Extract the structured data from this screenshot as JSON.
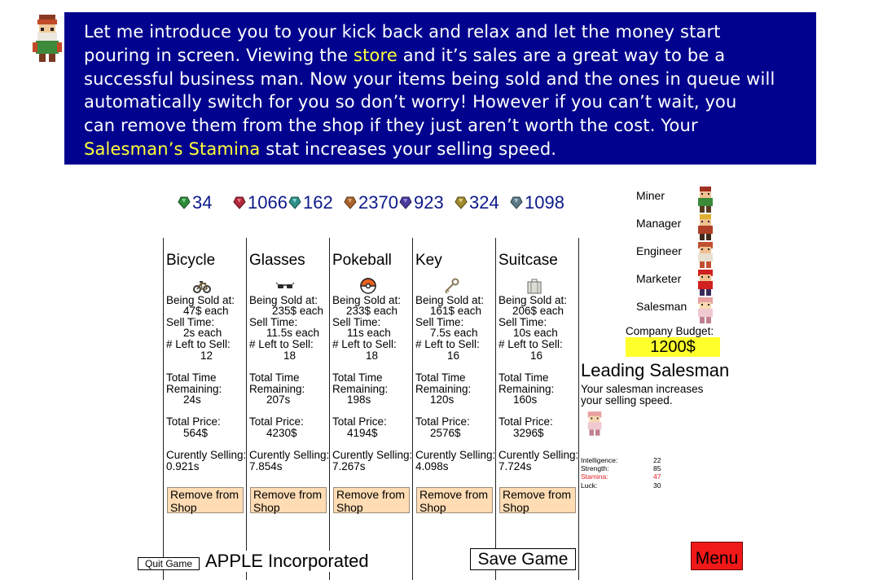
{
  "dialog": {
    "line1": "Let me introduce you to your kick back and relax and let the money start",
    "line2_pre": "pouring in screen. Viewing the ",
    "line2_hl": "store",
    "line2_post": " and it’s sales are a great way to be a",
    "line3": "successful business man. Now your items being sold and the ones in queue will",
    "line4": "automatically switch for you so don’t worry! However if you can’t wait, you",
    "line5": "can remove them from the shop if they just aren’t worth the cost. Your",
    "line6_hl": "Salesman’s Stamina",
    "line6_post": " stat increases your selling speed.",
    "highlight_color": "#ffff3a",
    "background_color": "#01038e"
  },
  "resources": [
    {
      "icon": "green-gem-icon",
      "color": "#2e8b3a",
      "value": "34"
    },
    {
      "icon": "red-gem-icon",
      "color": "#b0283a",
      "value": "1066"
    },
    {
      "icon": "teal-gem-icon",
      "color": "#2f8f88",
      "value": "162"
    },
    {
      "icon": "bronze-gem-icon",
      "color": "#a9642e",
      "value": "2370"
    },
    {
      "icon": "purple-gem-icon",
      "color": "#4a3c9a",
      "value": "923"
    },
    {
      "icon": "gold-gem-icon",
      "color": "#a08a30",
      "value": "324"
    },
    {
      "icon": "slate-gem-icon",
      "color": "#5e7a86",
      "value": "1098"
    }
  ],
  "labels": {
    "being_sold_at": "Being Sold at:",
    "sell_time": "Sell Time:",
    "left_to_sell": "# Left to Sell:",
    "total_time": "Total Time",
    "remaining": "Remaining:",
    "total_price": "Total Price:",
    "currently_selling": "Curently Selling:",
    "remove_button": "Remove from Shop"
  },
  "products": [
    {
      "name": "Bicycle",
      "icon": "bicycle-icon",
      "price": "47$ each",
      "sell_time": "2s each",
      "left": "12",
      "remaining": "24s",
      "total_price": "564$",
      "current": "0.921s"
    },
    {
      "name": "Glasses",
      "icon": "glasses-icon",
      "price": "235$ each",
      "sell_time": "11.5s each",
      "left": "18",
      "remaining": "207s",
      "total_price": "4230$",
      "current": "7.854s"
    },
    {
      "name": "Pokeball",
      "icon": "pokeball-icon",
      "price": "233$ each",
      "sell_time": "11s each",
      "left": "18",
      "remaining": "198s",
      "total_price": "4194$",
      "current": "7.267s"
    },
    {
      "name": "Key",
      "icon": "key-icon",
      "price": "161$ each",
      "sell_time": "7.5s each",
      "left": "16",
      "remaining": "120s",
      "total_price": "2576$",
      "current": "4.098s"
    },
    {
      "name": "Suitcase",
      "icon": "suitcase-icon",
      "price": "206$ each",
      "sell_time": "10s each",
      "left": "16",
      "remaining": "160s",
      "total_price": "3296$",
      "current": "7.724s"
    }
  ],
  "staff": [
    {
      "role": "Miner",
      "sprite": "miner-sprite-icon"
    },
    {
      "role": "Manager",
      "sprite": "manager-sprite-icon"
    },
    {
      "role": "Engineer",
      "sprite": "engineer-sprite-icon"
    },
    {
      "role": "Marketer",
      "sprite": "marketer-sprite-icon"
    },
    {
      "role": "Salesman",
      "sprite": "salesman-sprite-icon"
    }
  ],
  "budget": {
    "label": "Company Budget:",
    "value": "1200$",
    "color": "#ffff2b"
  },
  "leading": {
    "title": "Leading Salesman",
    "desc": "Your salesman increases your selling speed."
  },
  "stats": [
    {
      "name": "Intelligence:",
      "value": "22"
    },
    {
      "name": "Strength:",
      "value": "85"
    },
    {
      "name": "Stamina:",
      "value": "47",
      "highlight": "#e0202a"
    },
    {
      "name": "Luck:",
      "value": "30"
    }
  ],
  "footer": {
    "quit": "Quit Game",
    "company": "APPLE Incorporated",
    "save": "Save Game",
    "menu": "Menu",
    "menu_color": "#f01818"
  }
}
